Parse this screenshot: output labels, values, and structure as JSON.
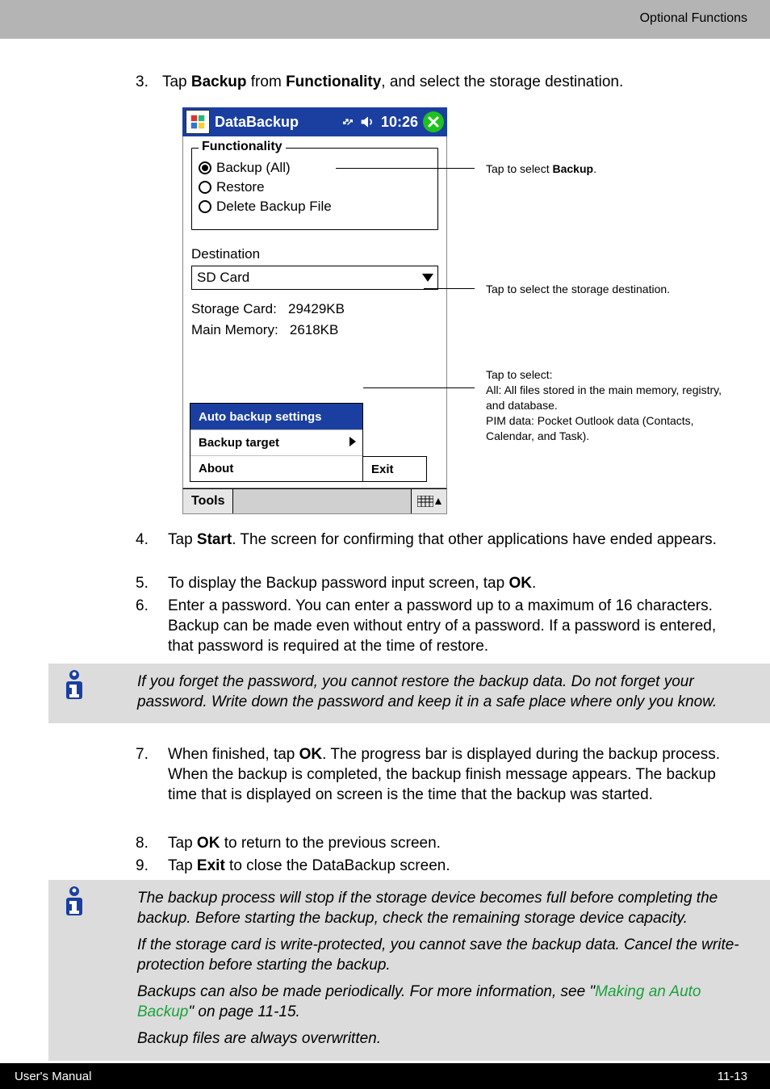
{
  "header": {
    "section": "Optional Functions"
  },
  "steps": {
    "s3": {
      "num": "3.",
      "pre": "Tap ",
      "b1": "Backup",
      "mid": " from ",
      "b2": "Functionality",
      "post": ", and select the storage destination."
    },
    "s4": {
      "num": "4.",
      "pre": "Tap ",
      "b": "Start",
      "post": ". The screen for confirming that other applications have ended appears."
    },
    "s5": {
      "num": "5.",
      "pre": "To display the Backup password input screen, tap ",
      "b": "OK",
      "post": "."
    },
    "s6": {
      "num": "6.",
      "txt": "Enter a password. You can enter a password up to a maximum of 16 characters. Backup can be made even without entry of a password. If a password is entered, that password is required at the time of restore."
    },
    "s7": {
      "num": "7.",
      "pre": "When finished, tap ",
      "b": "OK",
      "post": ". The progress bar is displayed during the backup process. When the backup is completed, the backup finish message appears. The backup time that is displayed on screen is the time that the backup was started."
    },
    "s8": {
      "num": "8.",
      "pre": "Tap ",
      "b": "OK",
      "post": " to return to the previous screen."
    },
    "s9": {
      "num": "9.",
      "pre": "Tap ",
      "b": "Exit",
      "post": " to close the DataBackup screen."
    }
  },
  "shot": {
    "title": "DataBackup",
    "clock": "10:26",
    "fieldset_legend": "Functionality",
    "radios": {
      "backup": "Backup (All)",
      "restore": "Restore",
      "delete": "Delete Backup File"
    },
    "dest_label": "Destination",
    "dest_value": "SD Card",
    "storage_card_label": "Storage Card:",
    "storage_card_value": "29429KB",
    "main_memory_label": "Main Memory:",
    "main_memory_value": "2618KB",
    "menu": {
      "auto": "Auto backup settings",
      "target": "Backup target",
      "about": "About",
      "exit": "Exit"
    },
    "tools": "Tools"
  },
  "callouts": {
    "c1a": "Tap to select ",
    "c1b": "Backup",
    "c1c": ".",
    "c2": "Tap to select the storage destination.",
    "c3": "Tap to select:\nAll: All files stored in the main memory, registry, and database.\nPIM data: Pocket Outlook data (Contacts, Calendar, and Task)."
  },
  "note1": "If you forget the password, you cannot restore the backup data. Do not forget your password. Write down the password and keep it in a safe place where only you know.",
  "note2": {
    "p1": "The backup process will stop if the storage device becomes full before completing the backup. Before starting the backup, check the remaining storage device capacity.",
    "p2": "If the storage card is write-protected, you cannot save the backup data. Cancel the write-protection before starting the backup.",
    "p3a": "Backups can also be made periodically. For more information, see \"",
    "p3link": "Making an Auto Backup",
    "p3b": "\" on page 11-15.",
    "p4": "Backup files are always overwritten."
  },
  "footer": {
    "left": "User's Manual",
    "right": "11-13"
  }
}
